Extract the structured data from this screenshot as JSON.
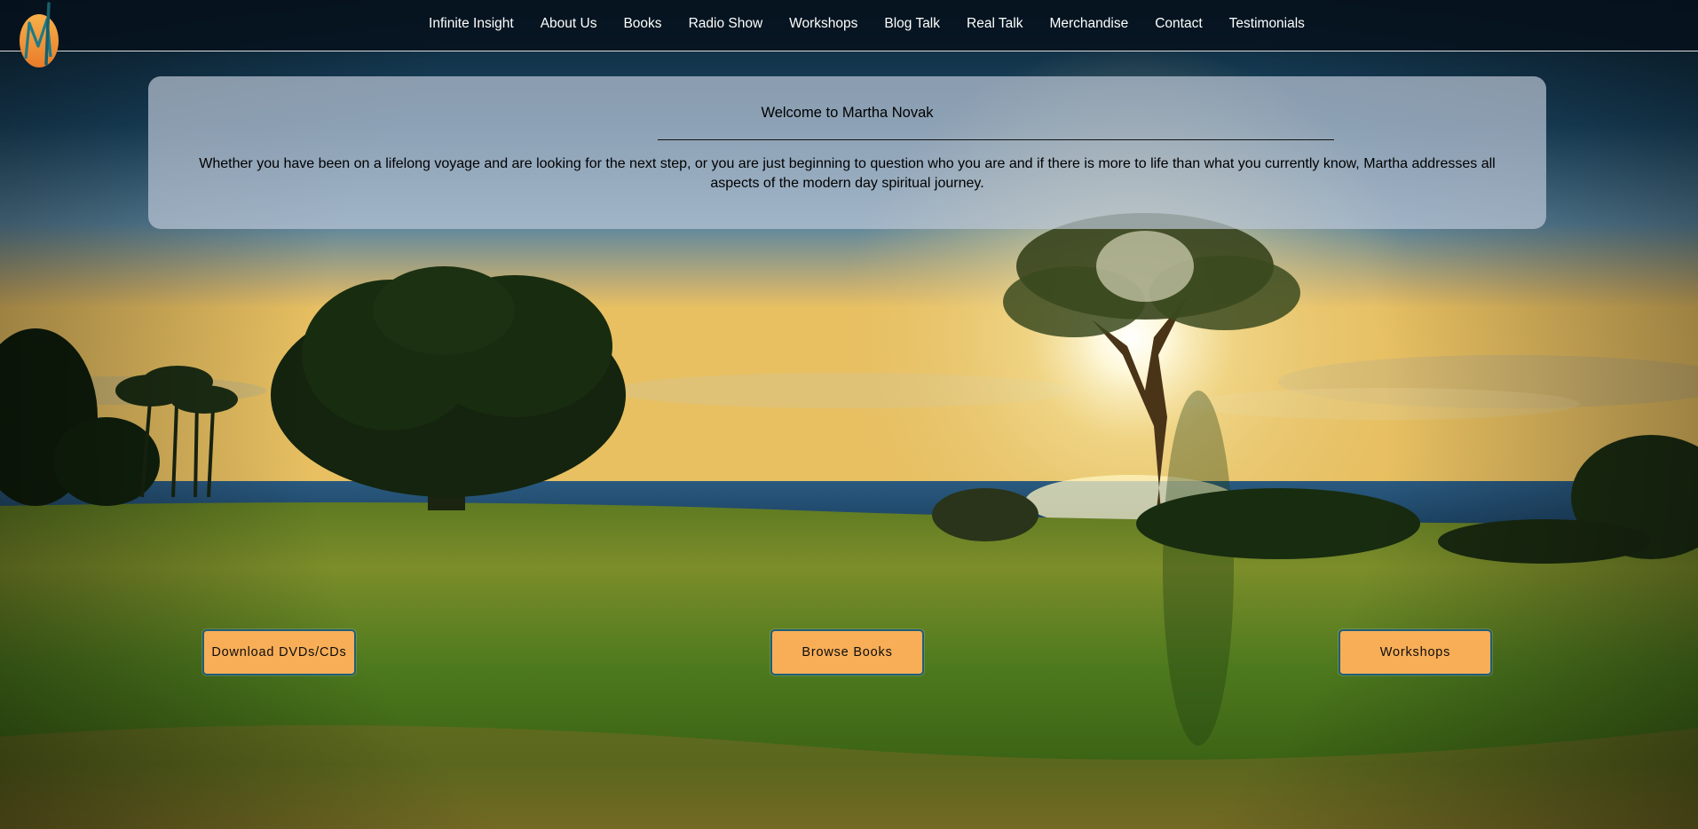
{
  "nav": {
    "items": [
      {
        "label": "Infinite Insight"
      },
      {
        "label": "About Us"
      },
      {
        "label": "Books"
      },
      {
        "label": "Radio Show"
      },
      {
        "label": "Workshops"
      },
      {
        "label": "Blog Talk"
      },
      {
        "label": "Real Talk"
      },
      {
        "label": "Merchandise"
      },
      {
        "label": "Contact"
      },
      {
        "label": "Testimonials"
      }
    ]
  },
  "logo": {
    "icon": "martha-novak-m-logo-icon",
    "letter": "M"
  },
  "welcome": {
    "title": "Welcome to Martha Novak",
    "body": "Whether you have been on a lifelong voyage and are looking for the next step, or you are just beginning to question who you are and if there is more to life than what you currently know, Martha addresses all aspects of the modern day spiritual journey."
  },
  "buttons": {
    "download": "Download DVDs/CDs",
    "books": "Browse Books",
    "workshops": "Workshops"
  },
  "colors": {
    "nav_bg": "#06121e",
    "button_bg": "#f8ae57",
    "button_border": "#1f5e78",
    "logo_orange": "#f29a3a",
    "logo_teal": "#1f7a86"
  }
}
